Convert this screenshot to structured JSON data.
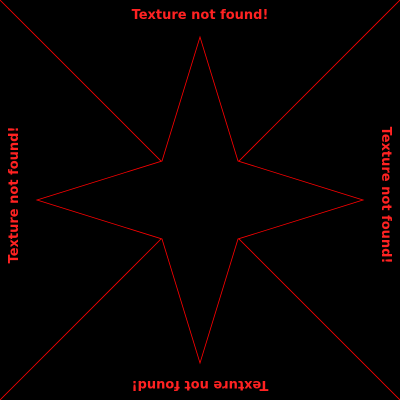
{
  "message": "Texture not found!",
  "colors": {
    "background": "#000000",
    "lines": "#ff0000",
    "text": "#ff2222"
  },
  "icons": {
    "star": "four-point-star-icon",
    "diagonals": "diagonal-cross-lines"
  }
}
